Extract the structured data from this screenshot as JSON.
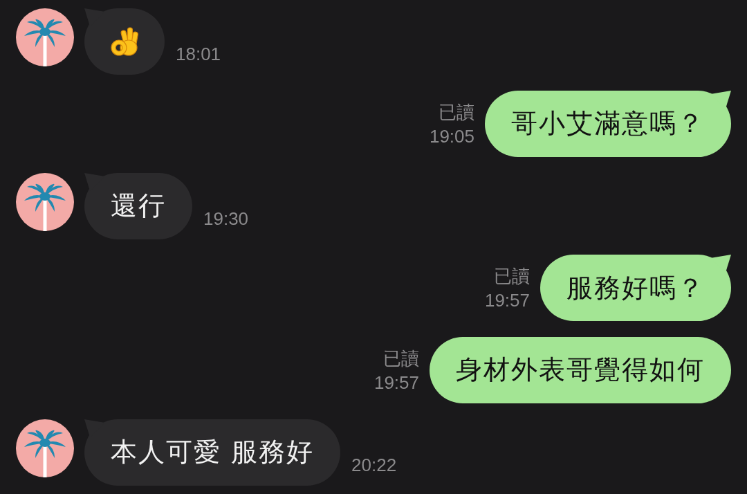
{
  "messages": [
    {
      "kind": "incoming",
      "tail": true,
      "content": {
        "kind": "emoji"
      },
      "time": "18:01"
    },
    {
      "kind": "outgoing",
      "tail": true,
      "content": {
        "kind": "text",
        "text": "哥小艾滿意嗎？"
      },
      "read_label": "已讀",
      "time": "19:05"
    },
    {
      "kind": "incoming",
      "tail": true,
      "content": {
        "kind": "text",
        "text": "還行"
      },
      "time": "19:30"
    },
    {
      "kind": "outgoing",
      "tail": true,
      "content": {
        "kind": "text",
        "text": "服務好嗎？"
      },
      "read_label": "已讀",
      "time": "19:57"
    },
    {
      "kind": "outgoing",
      "tail": false,
      "content": {
        "kind": "text",
        "text": "身材外表哥覺得如何"
      },
      "read_label": "已讀",
      "time": "19:57"
    },
    {
      "kind": "incoming",
      "tail": true,
      "content": {
        "kind": "text",
        "text": "本人可愛 服務好"
      },
      "time": "20:22"
    }
  ]
}
